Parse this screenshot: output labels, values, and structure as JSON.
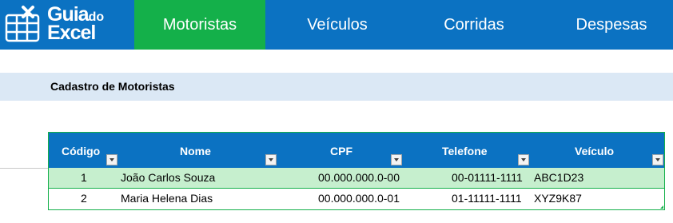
{
  "logo": {
    "word1": "Guia",
    "word2": "do",
    "word3": "Excel"
  },
  "nav": {
    "tabs": [
      {
        "label": "Motoristas",
        "active": true
      },
      {
        "label": "Veículos",
        "active": false
      },
      {
        "label": "Corridas",
        "active": false
      },
      {
        "label": "Despesas",
        "active": false
      }
    ]
  },
  "section": {
    "title": "Cadastro de Motoristas"
  },
  "table": {
    "columns": [
      "Código",
      "Nome",
      "CPF",
      "Telefone",
      "Veículo"
    ],
    "rows": [
      [
        "1",
        "João Carlos Souza",
        "00.000.000.0-00",
        "00-01111-1111",
        "ABC1D23"
      ],
      [
        "2",
        "Maria Helena Dias",
        "00.000.000.0-01",
        "01-11111-1111",
        "XYZ9K87"
      ]
    ]
  },
  "colors": {
    "brand_blue": "#0b72c2",
    "active_green": "#14b04a",
    "section_band": "#dbe8f5",
    "row_highlight": "#c6efce"
  }
}
